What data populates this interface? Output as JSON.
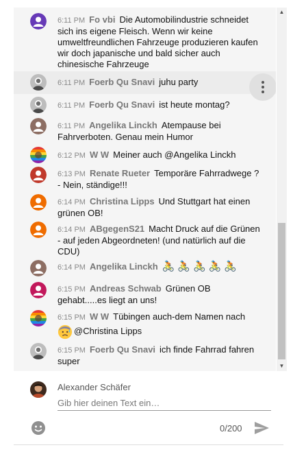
{
  "colors": {
    "chat_background": "#f5f5f5",
    "timestamp": "#888888",
    "author": "#777777",
    "scroll_thumb": "#c1c1c1"
  },
  "messages": [
    {
      "time": "6:11 PM",
      "author": "Fo vbi",
      "text": "Die Automobilindustrie schneidet sich ins eigene Fleisch. Wenn wir keine umweltfreundlichen Fahrzeuge produzieren kaufen wir doch japanische und bald sicher auch chinesische Fahrzeuge",
      "avatar": "purple-person-avatar"
    },
    {
      "time": "6:11 PM",
      "author": "Foerb Qu Snavi",
      "text": "juhu party",
      "avatar": "grey-photo-avatar"
    },
    {
      "time": "6:11 PM",
      "author": "Foerb Qu Snavi",
      "text": "ist heute montag?",
      "avatar": "grey-photo-avatar"
    },
    {
      "time": "6:11 PM",
      "author": "Angelika Linckh",
      "text": "Atempause bei Fahrverboten. Genau mein Humor",
      "avatar": "brown-person-avatar"
    },
    {
      "time": "6:12 PM",
      "author": "W W",
      "text": "Meiner auch @Angelika Linckh",
      "avatar": "rainbow-photo-avatar"
    },
    {
      "time": "6:13 PM",
      "author": "Renate Rueter",
      "text": "Temporäre Fahrradwege ? - Nein, ständige!!!",
      "avatar": "red-person-avatar"
    },
    {
      "time": "6:14 PM",
      "author": "Christina Lipps",
      "text": "Und Stuttgart hat einen grünen OB!",
      "avatar": "orange-person-avatar"
    },
    {
      "time": "6:14 PM",
      "author": "ABgegenS21",
      "text": "Macht Druck auf die Grünen - auf jeden Abgeordneten! (und natürlich auf die CDU)",
      "avatar": "orange-person-avatar"
    },
    {
      "time": "6:14 PM",
      "author": "Angelika Linckh",
      "text": "🚴🚴🚴🚴🚴",
      "avatar": "brown-person-avatar"
    },
    {
      "time": "6:15 PM",
      "author": "Andreas Schwab",
      "text": "Grünen OB gehabt.....es liegt an uns!",
      "avatar": "pink-person-avatar"
    },
    {
      "time": "6:15 PM",
      "author": "W W",
      "text": "Tübingen auch-dem Namen nach",
      "mention": "@Christina Lipps",
      "avatar": "rainbow-photo-avatar",
      "emoji": "sad-sweat-face-emoji"
    },
    {
      "time": "6:15 PM",
      "author": "Foerb Qu Snavi",
      "text": "ich finde Fahrrad fahren super",
      "avatar": "grey-photo-avatar"
    }
  ],
  "compose": {
    "user_name": "Alexander Schäfer",
    "placeholder": "Gib hier deinen Text ein…",
    "counter": "0/200"
  },
  "icons": {
    "more": "more-vert-icon",
    "emoji": "emoji-smile-icon",
    "send": "send-icon",
    "scroll_up": "scroll-up-arrow-icon",
    "scroll_down": "scroll-down-arrow-icon"
  }
}
